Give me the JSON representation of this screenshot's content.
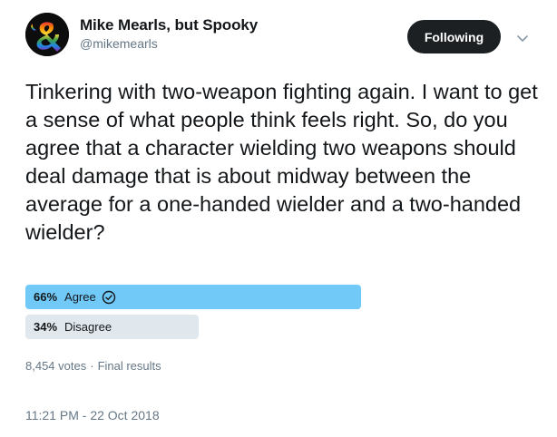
{
  "author": {
    "display_name": "Mike Mearls, but Spooky",
    "handle": "@mikemearls",
    "avatar_icon": "rainbow-ampersand-logo"
  },
  "follow_button": {
    "label": "Following"
  },
  "menu_icon": "chevron-down-icon",
  "tweet": {
    "text": "Tinkering with two-weapon fighting again. I want to get a sense of what people think feels right. So, do you agree that a character wielding two weapons should deal damage that is about midway between the average for a one-handed wielder and a two-handed wielder?"
  },
  "poll": {
    "options": [
      {
        "percent": "66%",
        "label": "Agree",
        "selected": true,
        "fraction": 0.66,
        "color": "#71c9f8"
      },
      {
        "percent": "34%",
        "label": "Disagree",
        "selected": false,
        "fraction": 0.34,
        "color": "#e1e8ed"
      }
    ],
    "votes": "8,454 votes",
    "status": "Final results"
  },
  "timestamp": "11:21 PM - 22 Oct 2018",
  "colors": {
    "text": "#14171a",
    "muted": "#657786",
    "button_bg": "#1c2022"
  }
}
